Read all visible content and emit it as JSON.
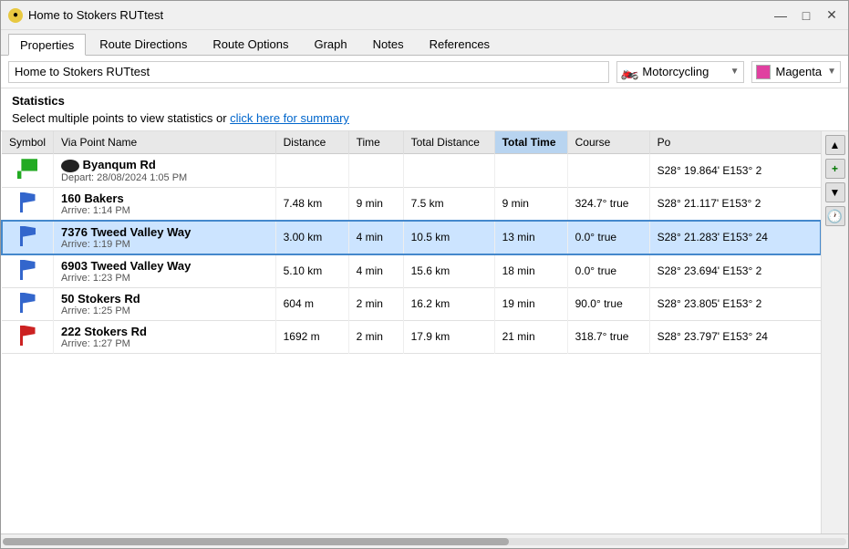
{
  "window": {
    "title": "Home to Stokers RUTtest",
    "icon": "●"
  },
  "titlebar": {
    "minimize_label": "—",
    "maximize_label": "□",
    "close_label": "✕"
  },
  "tabs": [
    {
      "id": "properties",
      "label": "Properties",
      "active": true
    },
    {
      "id": "route-directions",
      "label": "Route Directions"
    },
    {
      "id": "route-options",
      "label": "Route Options"
    },
    {
      "id": "graph",
      "label": "Graph"
    },
    {
      "id": "notes",
      "label": "Notes"
    },
    {
      "id": "references",
      "label": "References"
    }
  ],
  "toolbar": {
    "route_name": "Home to Stokers RUTtest",
    "transport_mode": "Motorcycling",
    "color_name": "Magenta"
  },
  "stats": {
    "title": "Statistics",
    "description": "Select multiple points to view statistics or click here for summary"
  },
  "table": {
    "columns": [
      {
        "id": "symbol",
        "label": "Symbol"
      },
      {
        "id": "via-point",
        "label": "Via Point Name"
      },
      {
        "id": "distance",
        "label": "Distance"
      },
      {
        "id": "time",
        "label": "Time"
      },
      {
        "id": "total-distance",
        "label": "Total Distance"
      },
      {
        "id": "total-time",
        "label": "Total Time",
        "active": true
      },
      {
        "id": "course",
        "label": "Course"
      },
      {
        "id": "position",
        "label": "Po"
      }
    ],
    "rows": [
      {
        "id": 1,
        "symbol": "🟢",
        "symbol_type": "green_flag",
        "via_name": "Byanqum Rd",
        "via_time": "Depart: 28/08/2024 1:05 PM",
        "distance": "",
        "time": "",
        "total_distance": "",
        "total_time": "",
        "course": "",
        "position": "S28° 19.864' E153° 2",
        "selected": false,
        "has_badge": true
      },
      {
        "id": 2,
        "symbol": "🏴",
        "symbol_type": "blue_flag",
        "via_name": "160 Bakers",
        "via_time": "Arrive: 1:14 PM",
        "distance": "7.48 km",
        "time": "9 min",
        "total_distance": "7.5 km",
        "total_time": "9 min",
        "course": "324.7° true",
        "position": "S28° 21.117' E153° 2",
        "selected": false
      },
      {
        "id": 3,
        "symbol": "🏴",
        "symbol_type": "blue_flag",
        "via_name": "7376 Tweed Valley Way",
        "via_time": "Arrive: 1:19 PM",
        "distance": "3.00 km",
        "time": "4 min",
        "total_distance": "10.5 km",
        "total_time": "13 min",
        "course": "0.0° true",
        "position": "S28° 21.283' E153° 24",
        "selected": true
      },
      {
        "id": 4,
        "symbol": "🏴",
        "symbol_type": "blue_flag",
        "via_name": "6903 Tweed Valley Way",
        "via_time": "Arrive: 1:23 PM",
        "distance": "5.10 km",
        "time": "4 min",
        "total_distance": "15.6 km",
        "total_time": "18 min",
        "course": "0.0° true",
        "position": "S28° 23.694' E153° 2",
        "selected": false
      },
      {
        "id": 5,
        "symbol": "🏴",
        "symbol_type": "blue_flag",
        "via_name": "50 Stokers Rd",
        "via_time": "Arrive: 1:25 PM",
        "distance": "604 m",
        "time": "2 min",
        "total_distance": "16.2 km",
        "total_time": "19 min",
        "course": "90.0° true",
        "position": "S28° 23.805' E153° 2",
        "selected": false
      },
      {
        "id": 6,
        "symbol": "🚩",
        "symbol_type": "red_flag",
        "via_name": "222 Stokers Rd",
        "via_time": "Arrive: 1:27 PM",
        "distance": "1692 m",
        "time": "2 min",
        "total_distance": "17.9 km",
        "total_time": "21 min",
        "course": "318.7° true",
        "position": "S28° 23.797' E153° 24",
        "selected": false
      }
    ]
  },
  "side_buttons": {
    "up": "▲",
    "add": "+",
    "down": "▼",
    "clock": "🕐"
  }
}
